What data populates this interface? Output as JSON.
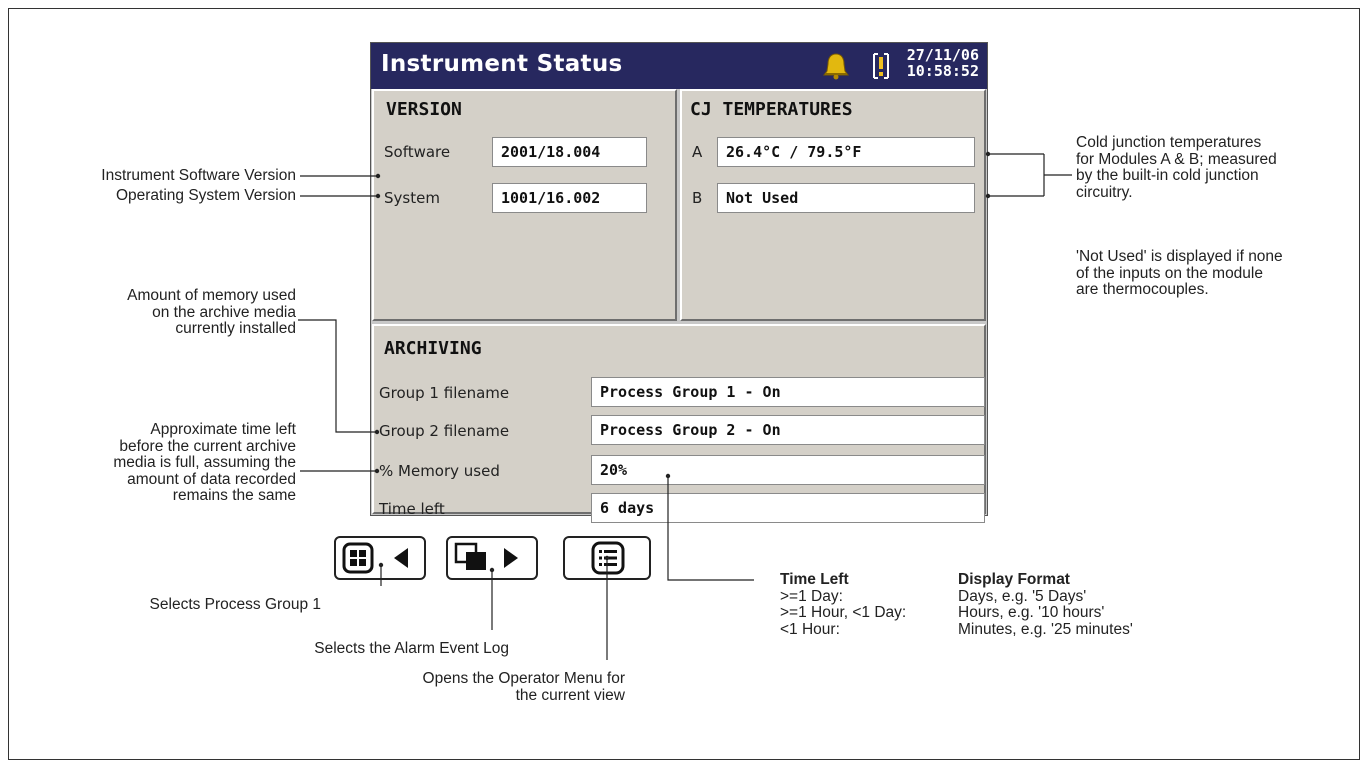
{
  "screen": {
    "title": "Instrument Status",
    "date": "27/11/06",
    "time": "10:58:52",
    "icons": [
      "alarm-bell-icon",
      "system-alert-icon"
    ],
    "colors": {
      "titlebar": "#27285f",
      "panel": "#d4d0c8",
      "bell": "#e2b80f"
    }
  },
  "version": {
    "heading": "VERSION",
    "software_label": "Software",
    "software_value": "2001/18.004",
    "system_label": "System",
    "system_value": "1001/16.002"
  },
  "cj": {
    "heading": "CJ TEMPERATURES",
    "a_label": "A",
    "a_value": "26.4°C / 79.5°F",
    "b_label": "B",
    "b_value": "Not Used"
  },
  "archiving": {
    "heading": "ARCHIVING",
    "rows": [
      {
        "label": "Group 1 filename",
        "value": "Process Group 1 - On"
      },
      {
        "label": "Group 2 filename",
        "value": "Process Group 2 - On"
      },
      {
        "label": "% Memory used",
        "value": "20%"
      },
      {
        "label": "Time left",
        "value": "6 days"
      }
    ]
  },
  "buttons": [
    {
      "icon": "process-group-icon"
    },
    {
      "icon": "alarm-event-log-icon"
    },
    {
      "icon": "operator-menu-icon"
    }
  ],
  "annotations": {
    "software_version": "Instrument Software Version",
    "os_version": "Operating System Version",
    "memory": [
      "Amount of memory used",
      "on the archive media",
      "currently installed"
    ],
    "time_left": [
      "Approximate time left",
      "before the current archive",
      "media is full, assuming the",
      "amount of data recorded",
      "remains the same"
    ],
    "cold_junction": [
      "Cold junction temperatures",
      "for Modules A & B; measured",
      "by the built-in cold junction",
      "circuitry."
    ],
    "not_used": [
      "'Not Used' is displayed if none",
      "of the inputs on the module",
      "are thermocouples."
    ],
    "btn1": "Selects Process Group 1",
    "btn2": "Selects the Alarm Event Log",
    "btn3": [
      "Opens the Operator Menu for",
      "the current view"
    ]
  },
  "legend": {
    "col1_heading": "Time Left",
    "col1": [
      ">=1 Day:",
      ">=1 Hour, <1 Day:",
      "<1 Hour:"
    ],
    "col2_heading": "Display Format",
    "col2": [
      "Days, e.g. '5 Days'",
      "Hours, e.g. '10 hours'",
      "Minutes, e.g. '25 minutes'"
    ]
  }
}
